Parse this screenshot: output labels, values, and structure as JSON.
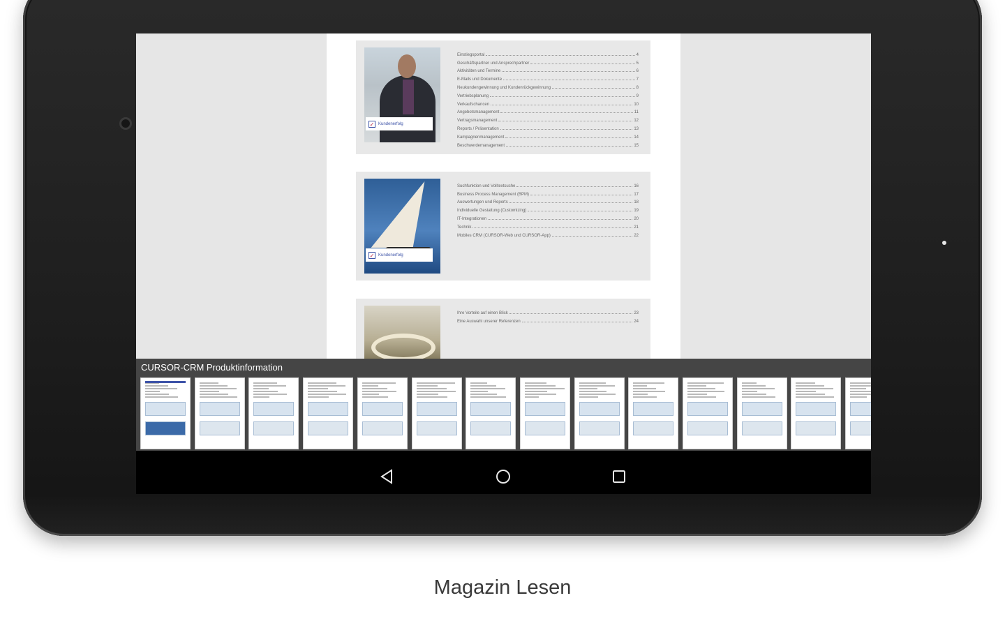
{
  "viewer": {
    "document_title": "CURSOR-CRM Produktinformation",
    "blocks": [
      {
        "badge": "Kundenerfolg",
        "toc": [
          {
            "label": "Einstiegsportal",
            "page": "4"
          },
          {
            "label": "Geschäftspartner und Ansprechpartner",
            "page": "5"
          },
          {
            "label": "Aktivitäten und Termine",
            "page": "6"
          },
          {
            "label": "E-Mails und Dokumente",
            "page": "7"
          },
          {
            "label": "Neukundengewinnung und Kundenrückgewinnung",
            "page": "8"
          },
          {
            "label": "Vertriebsplanung",
            "page": "9"
          },
          {
            "label": "Verkaufschancen",
            "page": "10"
          },
          {
            "label": "Angebotsmanagement",
            "page": "11"
          },
          {
            "label": "Vertragsmanagement",
            "page": "12"
          },
          {
            "label": "Reports / Präsentation",
            "page": "13"
          },
          {
            "label": "Kampagnenmanagement",
            "page": "14"
          },
          {
            "label": "Beschwerdemanagement",
            "page": "15"
          }
        ]
      },
      {
        "badge": "Kundenerfolg",
        "toc": [
          {
            "label": "Suchfunktion und Volltextsuche",
            "page": "16"
          },
          {
            "label": "Business Process Management (BPM)",
            "page": "17"
          },
          {
            "label": "Auswertungen und Reports",
            "page": "18"
          },
          {
            "label": "Individuelle Gestaltung (Customizing)",
            "page": "19"
          },
          {
            "label": "IT-Integrationen",
            "page": "20"
          },
          {
            "label": "Technik",
            "page": "21"
          },
          {
            "label": "Mobiles CRM (CURSOR-Web und CURSOR-App)",
            "page": "22"
          }
        ]
      },
      {
        "badge": "",
        "toc": [
          {
            "label": "Ihre Vorteile auf einen Blick",
            "page": "23"
          },
          {
            "label": "Eine Auswahl unserer Referenzen",
            "page": "24"
          }
        ]
      }
    ]
  },
  "navbar": {
    "back_icon": "back-triangle-icon",
    "home_icon": "home-circle-icon",
    "recents_icon": "recents-square-icon"
  },
  "caption": "Magazin Lesen",
  "colors": {
    "bezel": "#1f1f1f",
    "viewer_bg": "#e6e6e6",
    "thumb_bar": "#454545",
    "accent_blue": "#3e54a8"
  }
}
